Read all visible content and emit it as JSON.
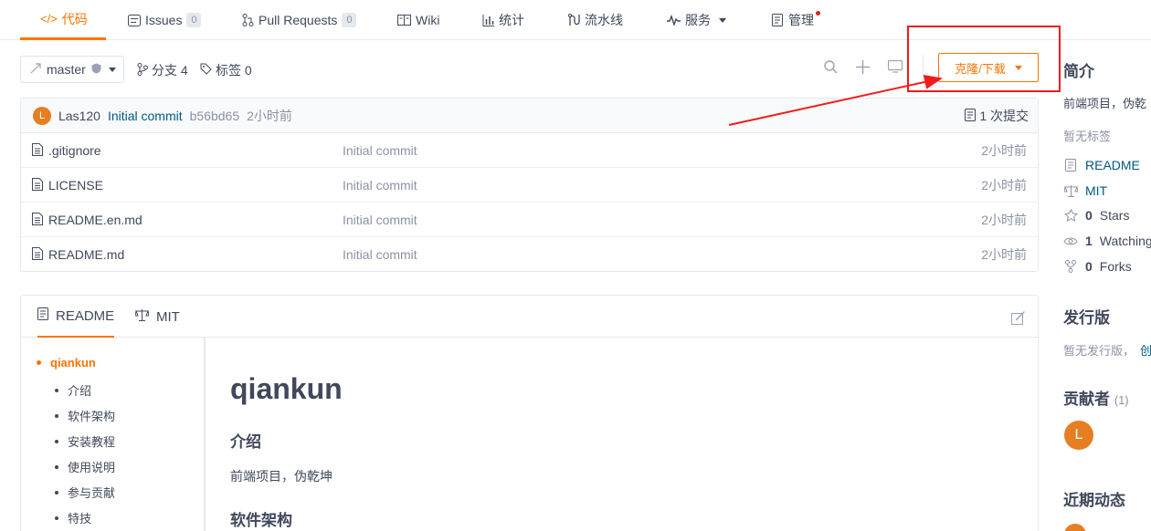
{
  "tabs": [
    {
      "label": "代码",
      "icon": "code-icon"
    },
    {
      "label": "Issues",
      "icon": "issues-icon",
      "badge": "0"
    },
    {
      "label": "Pull Requests",
      "icon": "pull-request-icon",
      "badge": "0"
    },
    {
      "label": "Wiki",
      "icon": "wiki-icon"
    },
    {
      "label": "统计",
      "icon": "stats-icon"
    },
    {
      "label": "流水线",
      "icon": "pipeline-icon"
    },
    {
      "label": "服务",
      "icon": "service-icon"
    },
    {
      "label": "管理",
      "icon": "manage-icon"
    }
  ],
  "toolbar": {
    "branch": "master",
    "branches_label": "分支 4",
    "tags_label": "标签 0",
    "clone_label": "克隆/下载"
  },
  "commit": {
    "avatar_letter": "L",
    "author": "Las120",
    "message": "Initial commit",
    "sha": "b56bd65",
    "time": "2小时前",
    "count_label": "1 次提交"
  },
  "files": [
    {
      "name": ".gitignore",
      "message": "Initial commit",
      "time": "2小时前"
    },
    {
      "name": "LICENSE",
      "message": "Initial commit",
      "time": "2小时前"
    },
    {
      "name": "README.en.md",
      "message": "Initial commit",
      "time": "2小时前"
    },
    {
      "name": "README.md",
      "message": "Initial commit",
      "time": "2小时前"
    }
  ],
  "readme": {
    "tabs": [
      "README",
      "MIT"
    ],
    "toc_top": "qiankun",
    "toc": [
      "介绍",
      "软件架构",
      "安装教程",
      "使用说明",
      "参与贡献",
      "特技"
    ],
    "title": "qiankun",
    "intro_heading": "介绍",
    "intro_text": "前端项目，伪乾坤",
    "arch_heading": "软件架构"
  },
  "sidebar": {
    "intro_title": "简介",
    "intro_text": "前端项目，伪乾",
    "no_tags": "暂无标签",
    "readme_link": "README",
    "license_link": "MIT",
    "stars_count": "0",
    "stars_label": "Stars",
    "watching_count": "1",
    "watching_label": "Watching",
    "forks_count": "0",
    "forks_label": "Forks",
    "releases_title": "发行版",
    "no_release": "暂无发行版，",
    "no_release_link": "创",
    "contributors_title": "贡献者",
    "contributors_count": "(1)",
    "contributor_letter": "L",
    "activity_title": "近期动态"
  },
  "colors": {
    "accent": "#fe7300",
    "link": "#005980",
    "annotation": "#f21b1b"
  }
}
